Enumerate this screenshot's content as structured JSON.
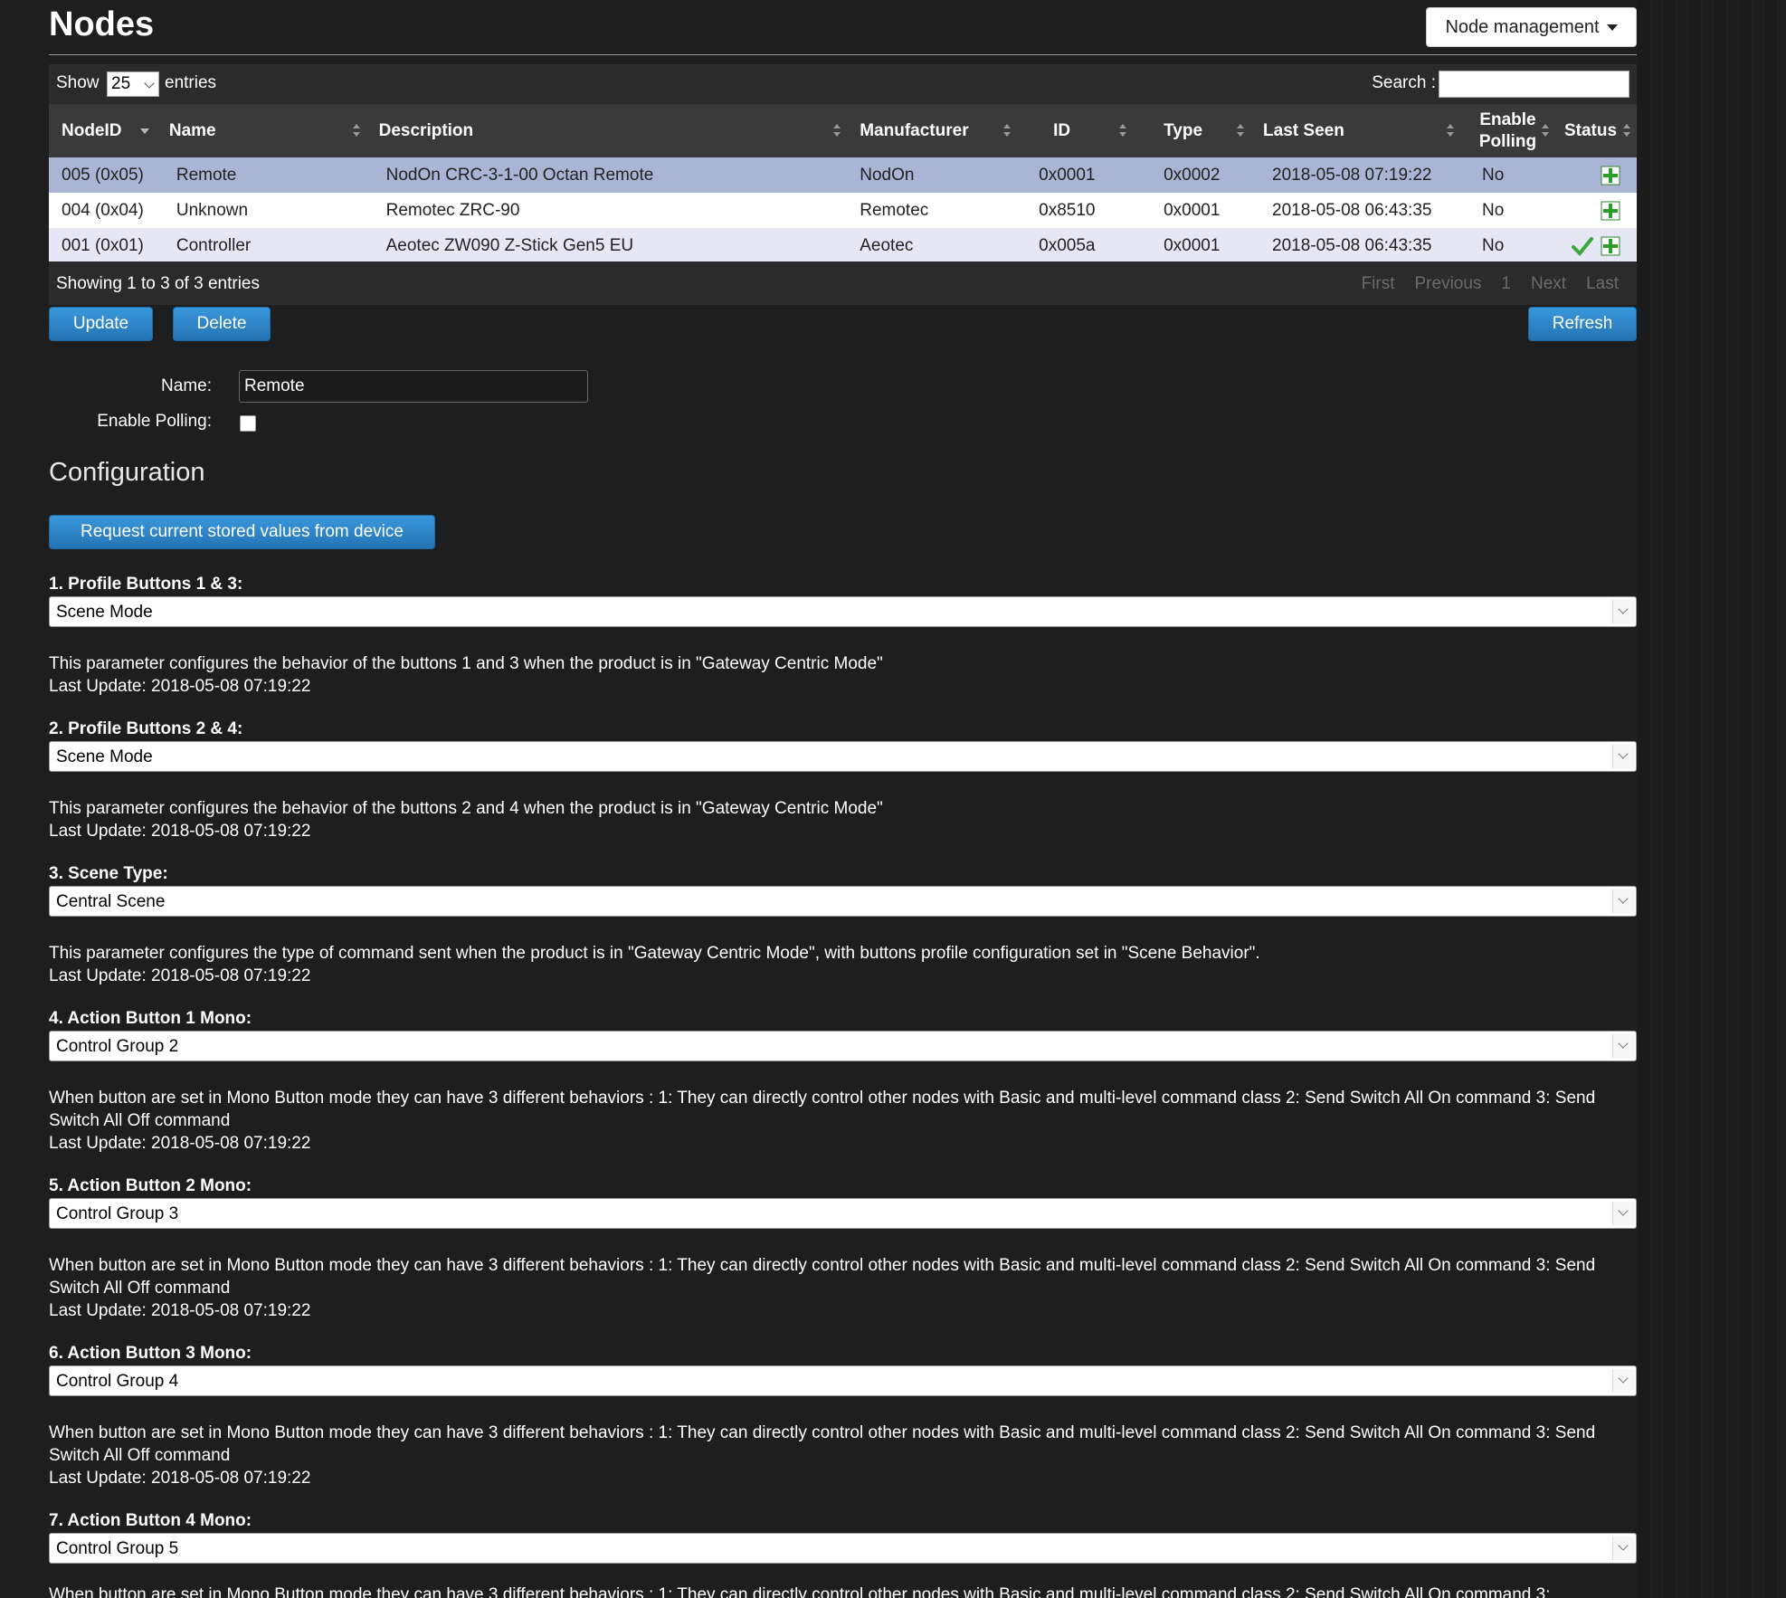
{
  "header": {
    "title": "Nodes",
    "node_management": "Node management"
  },
  "table_controls": {
    "show": "Show",
    "length": "25",
    "entries": "entries",
    "search": "Search :"
  },
  "columns": [
    "NodeID",
    "Name",
    "Description",
    "Manufacturer",
    "ID",
    "Type",
    "Last Seen",
    "Enable Polling",
    "Status"
  ],
  "rows": [
    {
      "nodeid": "005 (0x05)",
      "name": "Remote",
      "description": "NodOn CRC-3-1-00 Octan Remote",
      "manufacturer": "NodOn",
      "id": "0x0001",
      "type": "0x0002",
      "last_seen": "2018-05-08 07:19:22",
      "polling": "No",
      "status_icon": "moon-icon"
    },
    {
      "nodeid": "004 (0x04)",
      "name": "Unknown",
      "description": "Remotec ZRC-90",
      "manufacturer": "Remotec",
      "id": "0x8510",
      "type": "0x0001",
      "last_seen": "2018-05-08 06:43:35",
      "polling": "No",
      "status_icon": "moon-icon"
    },
    {
      "nodeid": "001 (0x01)",
      "name": "Controller",
      "description": "Aeotec ZW090 Z-Stick Gen5 EU",
      "manufacturer": "Aeotec",
      "id": "0x005a",
      "type": "0x0001",
      "last_seen": "2018-05-08 06:43:35",
      "polling": "No",
      "status_icon": "check-icon"
    }
  ],
  "footer": {
    "info": "Showing 1 to 3 of 3 entries",
    "pager": [
      "First",
      "Previous",
      "1",
      "Next",
      "Last"
    ]
  },
  "buttons": {
    "update": "Update",
    "delete": "Delete",
    "refresh": "Refresh",
    "request": "Request current stored values from device"
  },
  "form": {
    "name_label": "Name:",
    "name_value": "Remote",
    "polling_label": "Enable Polling:",
    "polling_checked": false
  },
  "configuration": {
    "title": "Configuration",
    "params": [
      {
        "label": "1. Profile Buttons 1 & 3:",
        "value": "Scene Mode",
        "desc": "This parameter configures the behavior of the buttons 1 and 3 when the product is in \"Gateway Centric Mode\"",
        "update": "Last Update: 2018-05-08 07:19:22"
      },
      {
        "label": "2. Profile Buttons 2 & 4:",
        "value": "Scene Mode",
        "desc": "This parameter configures the behavior of the buttons 2 and 4 when the product is in \"Gateway Centric Mode\"",
        "update": "Last Update: 2018-05-08 07:19:22"
      },
      {
        "label": "3. Scene Type:",
        "value": "Central Scene",
        "desc": "This parameter configures the type of command sent when the product is in \"Gateway Centric Mode\", with buttons profile configuration set in \"Scene Behavior\".",
        "update": "Last Update: 2018-05-08 07:19:22"
      },
      {
        "label": "4. Action Button 1 Mono:",
        "value": "Control Group 2",
        "desc": "When button are set in Mono Button mode they can have 3 different behaviors : 1: They can directly control other nodes with Basic and multi-level command class 2: Send Switch All On command 3: Send Switch All Off command",
        "update": "Last Update: 2018-05-08 07:19:22"
      },
      {
        "label": "5. Action Button 2 Mono:",
        "value": "Control Group 3",
        "desc": "When button are set in Mono Button mode they can have 3 different behaviors : 1: They can directly control other nodes with Basic and multi-level command class 2: Send Switch All On command 3: Send Switch All Off command",
        "update": "Last Update: 2018-05-08 07:19:22"
      },
      {
        "label": "6. Action Button 3 Mono:",
        "value": "Control Group 4",
        "desc": "When button are set in Mono Button mode they can have 3 different behaviors : 1: They can directly control other nodes with Basic and multi-level command class 2: Send Switch All On command 3: Send Switch All Off command",
        "update": "Last Update: 2018-05-08 07:19:22"
      },
      {
        "label": "7. Action Button 4 Mono:",
        "value": "Control Group 5",
        "desc": "When button are set in Mono Button mode they can have 3 different behaviors : 1: They can directly control other nodes with Basic and multi-level command class 2: Send Switch All On command 3:",
        "update": ""
      }
    ]
  },
  "colors": {
    "accent_blue": "#2a84c8",
    "selected_row": "#aab4d4",
    "odd_row": "#e7e6f4",
    "background": "#1e1e1e"
  }
}
